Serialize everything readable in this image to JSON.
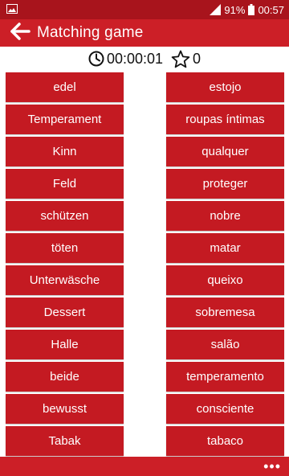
{
  "status_bar": {
    "battery": "91%",
    "time": "00:57"
  },
  "app_bar": {
    "title": "Matching game"
  },
  "info": {
    "timer": "00:00:01",
    "stars": "0"
  },
  "left_words": [
    "edel",
    "Temperament",
    "Kinn",
    "Feld",
    "schützen",
    "töten",
    "Unterwäsche",
    "Dessert",
    "Halle",
    "beide",
    "bewusst",
    "Tabak"
  ],
  "right_words": [
    "estojo",
    "roupas íntimas",
    "qualquer",
    "proteger",
    "nobre",
    "matar",
    "queixo",
    "sobremesa",
    "salão",
    "temperamento",
    "consciente",
    "tabaco"
  ],
  "bottom_bar": {
    "more": "•••"
  },
  "colors": {
    "primary": "#cc1f27",
    "status": "#a8141c",
    "tile": "#c41a22"
  }
}
